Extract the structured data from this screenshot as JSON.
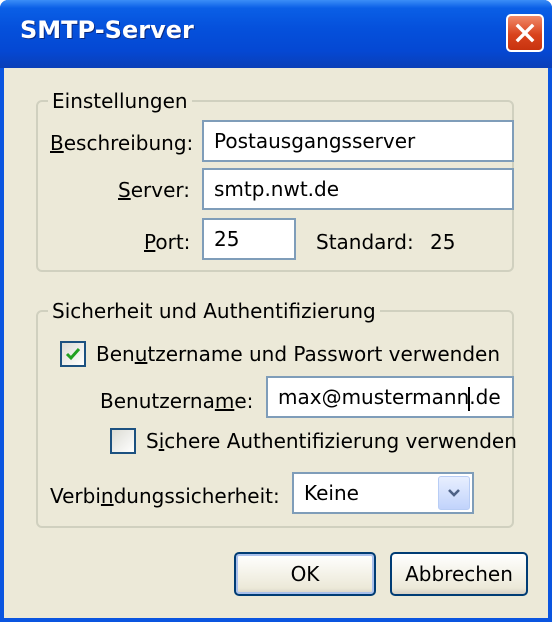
{
  "window": {
    "title": "SMTP-Server"
  },
  "settings": {
    "legend": "Einstellungen",
    "description_label_prefix": "",
    "description_label_ul": "B",
    "description_label_rest": "eschreibung:",
    "description_value": "Postausgangsserver",
    "server_label_ul": "S",
    "server_label_rest": "erver:",
    "server_value": "smtp.nwt.de",
    "port_label_ul": "P",
    "port_label_rest": "ort:",
    "port_value": "25",
    "standard_label": "Standard:",
    "standard_value": "25"
  },
  "security": {
    "legend": "Sicherheit und Authentifizierung",
    "use_credentials_pre": "Ben",
    "use_credentials_ul": "u",
    "use_credentials_rest": "tzername und Passwort verwenden",
    "use_credentials_checked": true,
    "username_label_pre": "Benutzerna",
    "username_label_ul": "m",
    "username_label_rest": "e:",
    "username_value_before_caret": "max@mustermann",
    "username_value_after_caret": ".de",
    "secure_auth_pre": "S",
    "secure_auth_ul": "i",
    "secure_auth_rest": "chere Authentifizierung verwenden",
    "secure_auth_checked": false,
    "connection_label_pre": "Verbi",
    "connection_label_ul": "n",
    "connection_label_rest": "dungssicherheit:",
    "connection_value": "Keine"
  },
  "buttons": {
    "ok": "OK",
    "cancel": "Abbrechen"
  },
  "colors": {
    "titlebar": "#0551dc",
    "dialog_bg": "#ece9d8",
    "field_border": "#7f9db9",
    "checkmark": "#21a121",
    "close": "#d9431d"
  }
}
